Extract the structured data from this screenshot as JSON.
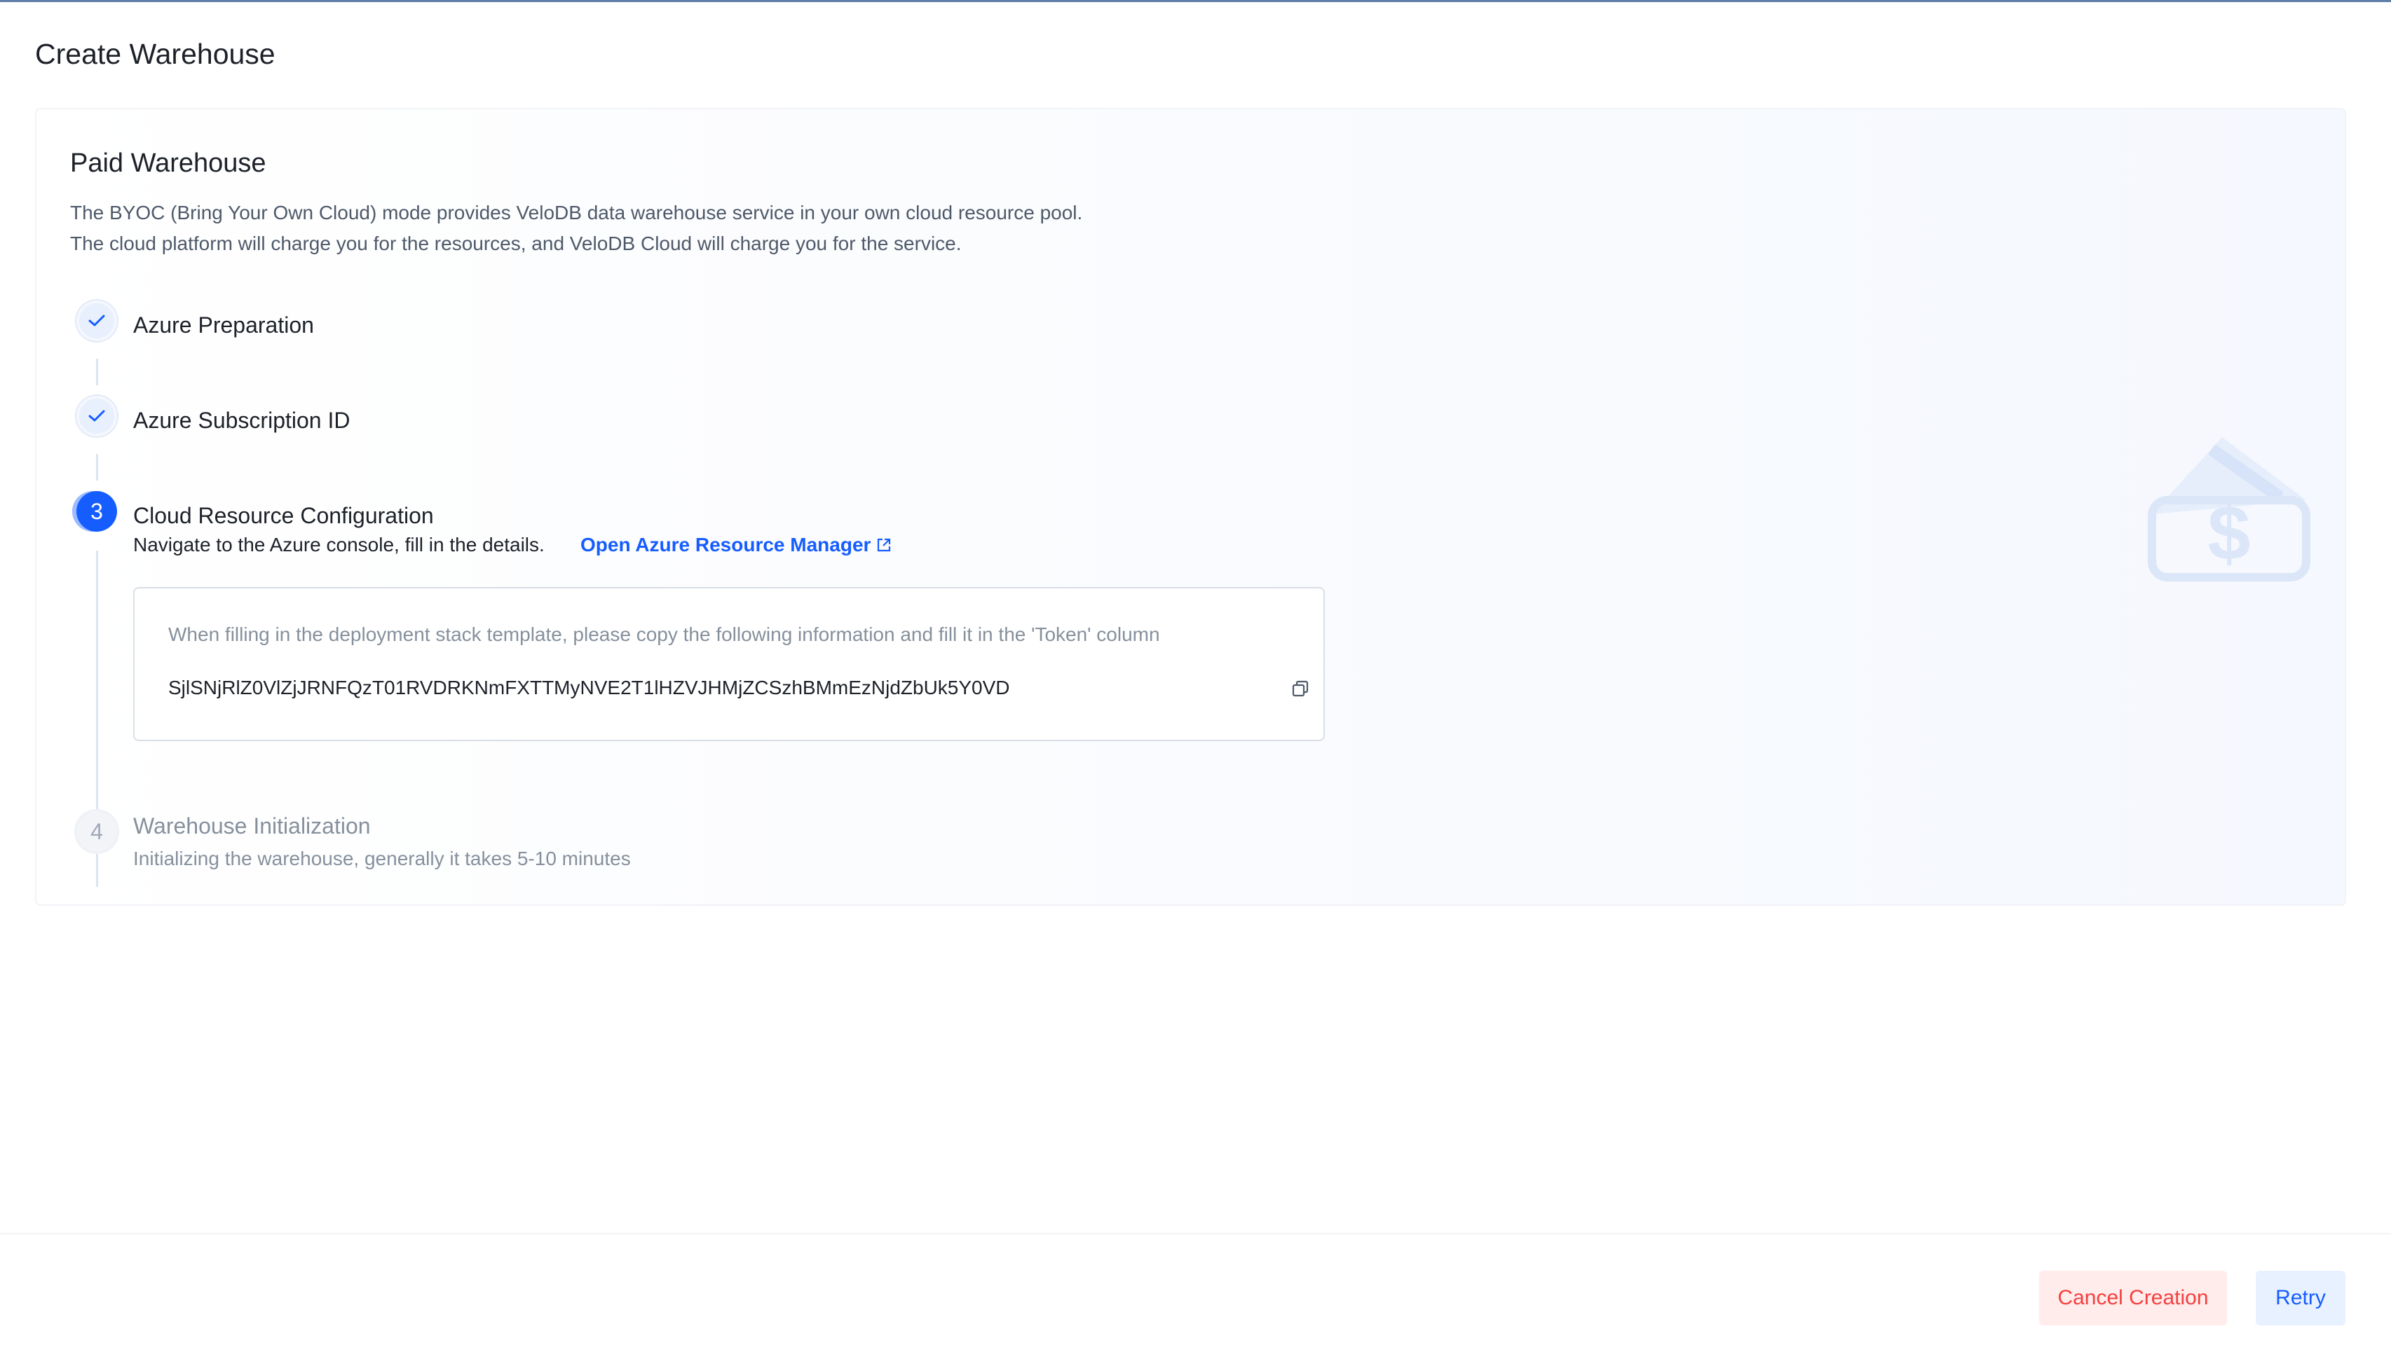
{
  "page": {
    "title": "Create Warehouse"
  },
  "card": {
    "title": "Paid Warehouse",
    "description_line1": "The BYOC (Bring Your Own Cloud) mode provides VeloDB data warehouse service in your own cloud resource pool.",
    "description_line2": "The cloud platform will charge you for the resources, and VeloDB Cloud will charge you for the service."
  },
  "steps": [
    {
      "status": "completed",
      "title": "Azure Preparation"
    },
    {
      "status": "completed",
      "title": "Azure Subscription ID"
    },
    {
      "status": "active",
      "number": "3",
      "title": "Cloud Resource Configuration",
      "description": "Navigate to the Azure console, fill in the details.",
      "link_label": "Open Azure Resource Manager",
      "token_hint": "When filling in the deployment stack template, please copy the following information and fill it in the 'Token' column",
      "token_value": "SjlSNjRlZ0VlZjJRNFQzT01RVDRKNmFXTTMyNVE2T1lHZVJHMjZCSzhBMmEzNjdZbUk5Y0VD"
    },
    {
      "status": "pending",
      "number": "4",
      "title": "Warehouse Initialization",
      "description": "Initializing the warehouse, generally it takes 5-10 minutes"
    }
  ],
  "footer": {
    "cancel_label": "Cancel Creation",
    "retry_label": "Retry"
  },
  "icons": {
    "check": "check-icon",
    "external_link": "external-link-icon",
    "copy": "copy-icon",
    "wallet": "wallet-icon"
  },
  "colors": {
    "primary": "#165dff",
    "danger": "#f53f3f",
    "muted_text": "#86909c"
  }
}
